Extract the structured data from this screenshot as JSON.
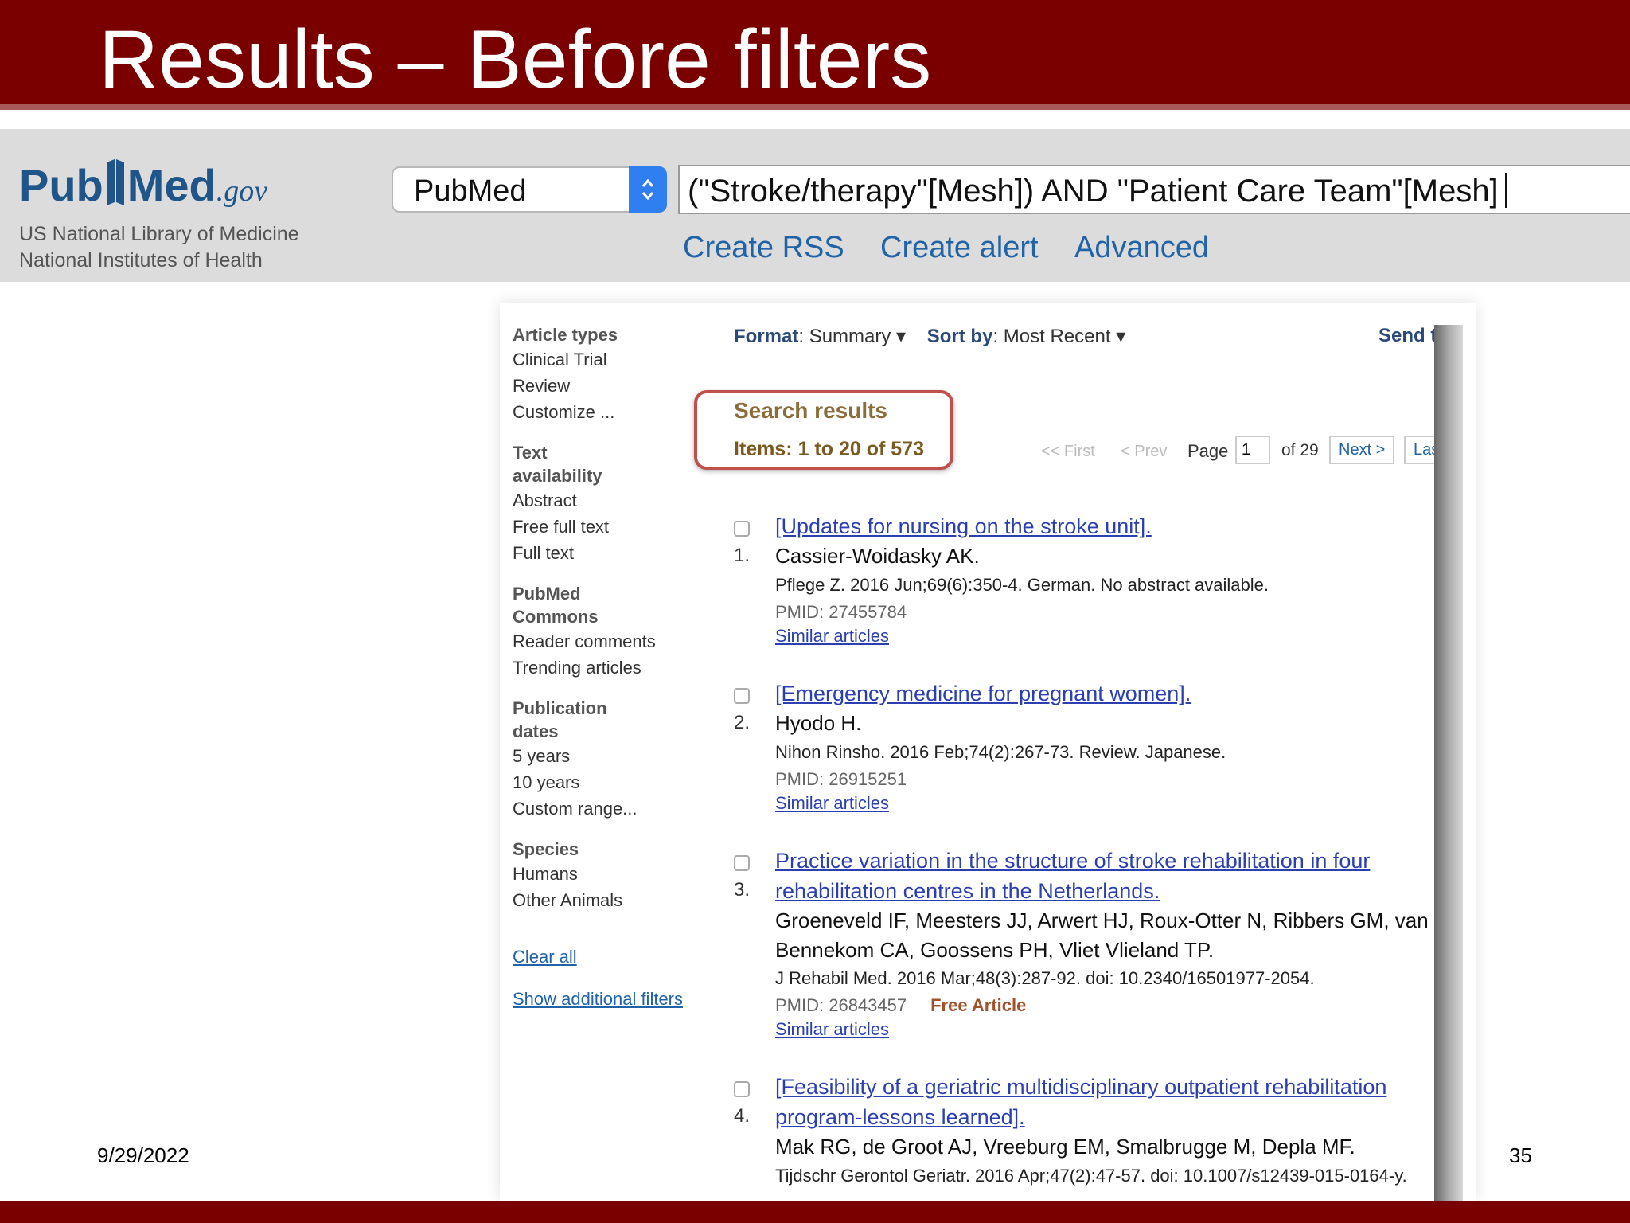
{
  "slide": {
    "title": "Results – Before filters",
    "date": "9/29/2022",
    "page_number": "35"
  },
  "pubmed": {
    "logo_pub": "Pub",
    "logo_med": "Med",
    "logo_gov": ".gov",
    "library_line1": "US National Library of Medicine",
    "library_line2": "National Institutes of Health",
    "database": "PubMed",
    "query": "(\"Stroke/therapy\"[Mesh]) AND \"Patient Care Team\"[Mesh]",
    "links": {
      "rss": "Create RSS",
      "alert": "Create alert",
      "advanced": "Advanced"
    }
  },
  "filters": {
    "article_types": {
      "heading": "Article types",
      "items": [
        "Clinical Trial",
        "Review",
        "Customize ..."
      ]
    },
    "text_availability": {
      "heading1": "Text",
      "heading2": "availability",
      "items": [
        "Abstract",
        "Free full text",
        "Full text"
      ]
    },
    "commons": {
      "heading1": "PubMed",
      "heading2": "Commons",
      "items": [
        "Reader comments",
        "Trending articles"
      ]
    },
    "pub_dates": {
      "heading1": "Publication",
      "heading2": "dates",
      "items": [
        "5 years",
        "10 years",
        "Custom range..."
      ]
    },
    "species": {
      "heading": "Species",
      "items": [
        "Humans",
        "Other Animals"
      ]
    },
    "clear_all": "Clear all",
    "show_additional": "Show additional filters"
  },
  "toolbar": {
    "format_label": "Format",
    "format_value": "Summary",
    "sort_label": "Sort by",
    "sort_value": "Most Recent",
    "send": "Send t"
  },
  "results_header": {
    "title": "Search results",
    "items": "Items: 1 to 20 of 573"
  },
  "pager": {
    "first": "<< First",
    "prev": "< Prev",
    "page_label": "Page",
    "page_value": "1",
    "of": "of 29",
    "next": "Next >",
    "last": "Last"
  },
  "results": [
    {
      "num": "1.",
      "title": "[Updates for nursing on the stroke unit].",
      "authors": "Cassier-Woidasky AK.",
      "citation": "Pflege Z. 2016 Jun;69(6):350-4. German. No abstract available.",
      "pmid": "PMID: 27455784",
      "similar": "Similar articles"
    },
    {
      "num": "2.",
      "title": "[Emergency medicine for pregnant women].",
      "authors": "Hyodo H.",
      "citation": "Nihon Rinsho. 2016 Feb;74(2):267-73. Review. Japanese.",
      "pmid": "PMID: 26915251",
      "similar": "Similar articles"
    },
    {
      "num": "3.",
      "title": "Practice variation in the structure of stroke rehabilitation in four rehabilitation centres in the Netherlands.",
      "authors": "Groeneveld IF, Meesters JJ, Arwert HJ, Roux-Otter N, Ribbers GM, van Bennekom CA, Goossens PH, Vliet Vlieland TP.",
      "citation": "J Rehabil Med. 2016 Mar;48(3):287-92. doi: 10.2340/16501977-2054.",
      "pmid": "PMID: 26843457",
      "free": "Free Article",
      "similar": "Similar articles"
    },
    {
      "num": "4.",
      "title": "[Feasibility of a geriatric multidisciplinary outpatient rehabilitation program-lessons learned].",
      "authors": "Mak RG, de Groot AJ, Vreeburg EM, Smalbrugge M, Depla MF.",
      "citation": "Tijdschr Gerontol Geriatr. 2016 Apr;47(2):47-57. doi: 10.1007/s12439-015-0164-y."
    }
  ],
  "colors": {
    "slide_bar": "#7a0000",
    "pubmed_blue": "#20558a",
    "link_blue": "#2b3fb0",
    "highlight_box": "#c0504d"
  }
}
